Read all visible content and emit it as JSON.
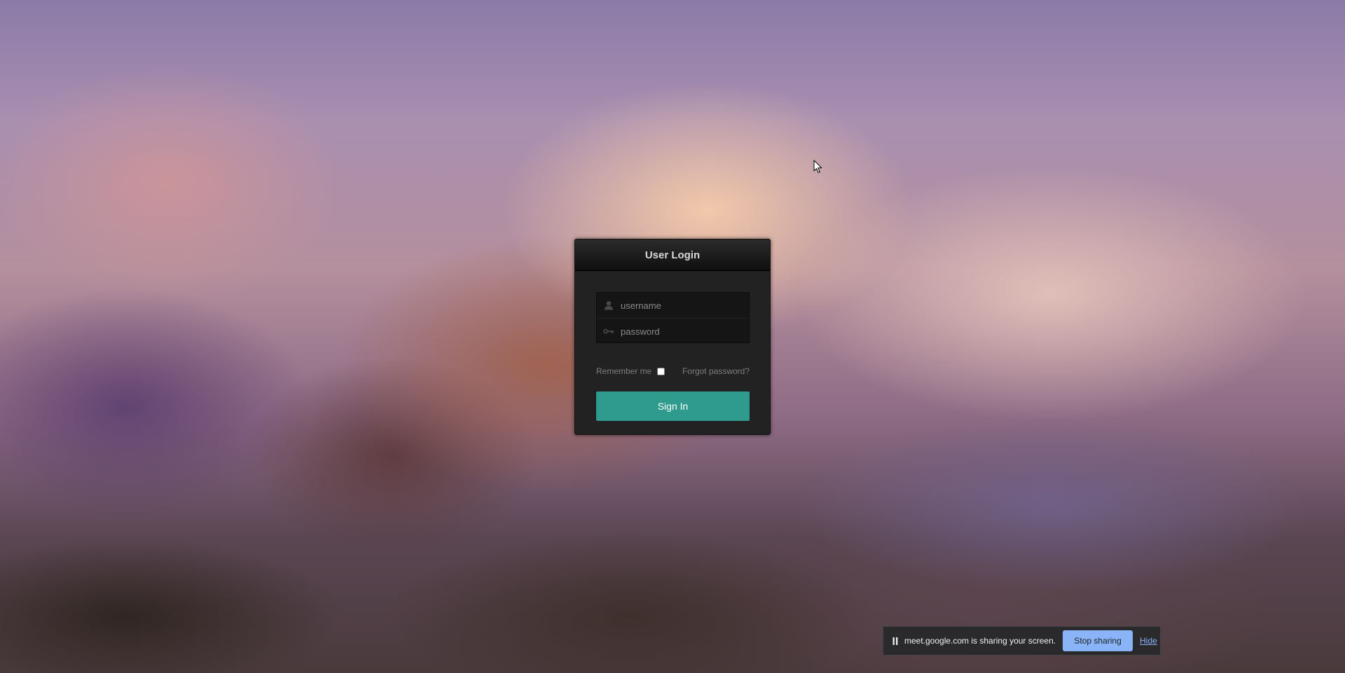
{
  "login": {
    "title": "User Login",
    "username_placeholder": "username",
    "password_placeholder": "password",
    "remember_label": "Remember me",
    "remember_checked": false,
    "forgot_label": "Forgot password?",
    "signin_label": "Sign In",
    "signin_color": "#2f9a8e"
  },
  "share_bar": {
    "message": "meet.google.com is sharing your screen.",
    "stop_label": "Stop sharing",
    "hide_label": "Hide",
    "button_color": "#8ab4f8"
  },
  "icons": {
    "username": "user-icon",
    "password": "key-icon",
    "share": "pause-icon",
    "cursor": "mouse-cursor-icon"
  }
}
